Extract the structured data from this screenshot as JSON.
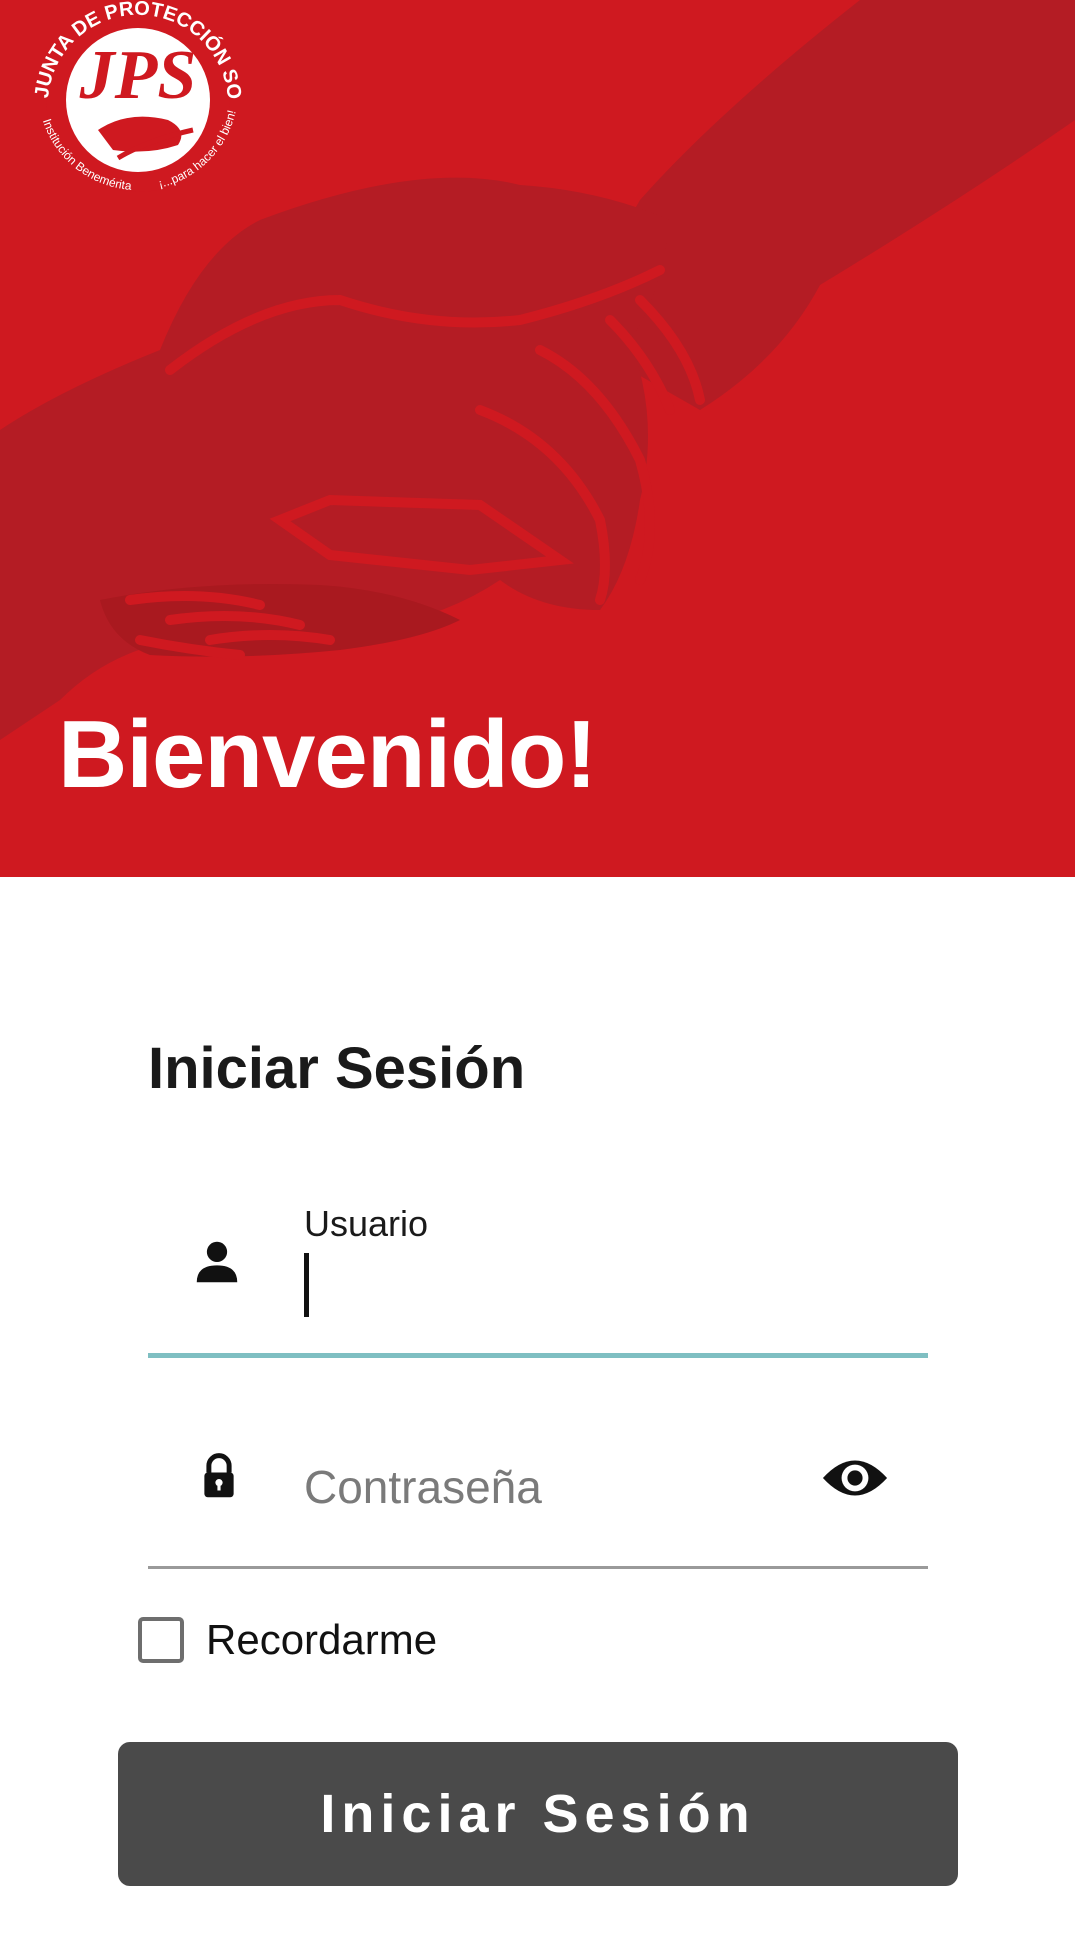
{
  "header": {
    "welcome_text": "Bienvenido!",
    "background_color": "#cf1920",
    "logo": {
      "icon": "jps-logo-icon",
      "ring_text_top": "JUNTA DE PROTECCIÓN SOCIAL",
      "ring_text_bottom_left": "Institución Benemérita",
      "ring_text_bottom_right": "¡...para hacer el bien!",
      "initials": "JPS"
    }
  },
  "login_form": {
    "title": "Iniciar Sesión",
    "username": {
      "label": "Usuario",
      "value": "",
      "icon": "person-icon",
      "focused": true,
      "underline_color": "#7fbfc2"
    },
    "password": {
      "placeholder": "Contraseña",
      "value": "",
      "icon": "lock-icon",
      "toggle_icon": "eye-icon"
    },
    "remember": {
      "label": "Recordarme",
      "checked": false
    },
    "submit_label": "Iniciar Sesión",
    "submit_color": "#4a4a4a"
  }
}
